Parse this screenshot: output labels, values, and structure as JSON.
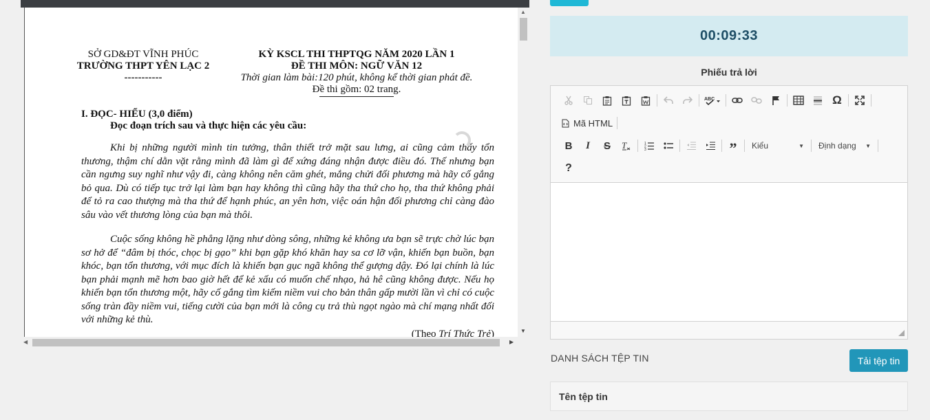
{
  "document": {
    "header_left": [
      "SỞ GD&ĐT VĨNH PHÚC",
      "TRƯỜNG THPT YÊN LẠC 2",
      "-----------"
    ],
    "header_right": [
      "KỲ KSCL THI THPTQG NĂM 2020 LẦN 1",
      "ĐỀ THI MÔN: NGỮ VĂN 12",
      "Thời gian làm bài:120 phút, không kể thời gian phát đề.",
      "Đề thi gồm: 02 trang."
    ],
    "section_title": "I. ĐỌC- HIỂU (3,0 điểm)",
    "section_instruction": "Đọc đoạn trích sau và thực hiện các yêu cầu:",
    "paragraph_1": "Khi bị những người mình tin tưởng, thân thiết trở mặt sau lưng, ai cũng cảm thấy tổn thương, thậm chí dằn vặt rằng mình đã làm gì để xứng đáng nhận được điều đó. Thế nhưng bạn cần ngưng suy nghĩ như vậy đi, càng không nên căm ghét, mắng chửi đối phương mà hãy cố gắng bỏ qua. Dù có tiếp tục trở lại làm bạn hay không thì cũng hãy tha thứ cho họ, tha thứ không phải để tỏ ra cao thượng mà tha thứ để hạnh phúc, an yên hơn, việc oán hận đối phương chỉ càng đào sâu vào vết thương lòng của bạn mà thôi.",
    "paragraph_2": "Cuộc sống không hề phẳng lặng như dòng sông, những kẻ không ưa bạn sẽ trực chờ lúc bạn sơ hở để “đâm bị thóc, chọc bị gạo” khi bạn gặp khó khăn hay sa cơ lỡ vận, khiến bạn buồn, bạn khóc, bạn tổn thương, với mục đích là khiến bạn gục ngã không thể gượng dậy. Đó lại chính là lúc bạn phải mạnh mẽ hơn bao giờ hết để kẻ xấu có muốn chế nhạo, hả hê cũng không được. Nếu họ khiến bạn tổn thương một, hãy cố gắng tìm kiếm niềm vui cho bản thân gấp mười lần vì chỉ có cuộc sống tràn đầy niềm vui, tiếng cười của bạn mới là công cụ trả thù ngọt ngào mà chí mạng nhất đối với những kẻ thù.",
    "source_prefix": "(Theo ",
    "source_name": "Trí Thức Trẻ",
    "source_suffix": ")"
  },
  "timer": "00:09:33",
  "answer_label": "Phiếu trả lời",
  "editor": {
    "source_label": "Mã HTML",
    "style_label": "Kiểu",
    "format_label": "Định dạng",
    "help": "?"
  },
  "files": {
    "list_label": "DANH SÁCH TỆP TIN",
    "upload_label": "Tải tệp tin",
    "column_name": "Tên tệp tin"
  },
  "colors": {
    "accent": "#2196b9",
    "timer_bg": "#d4ebf1",
    "timer_text": "#1e4e66"
  }
}
